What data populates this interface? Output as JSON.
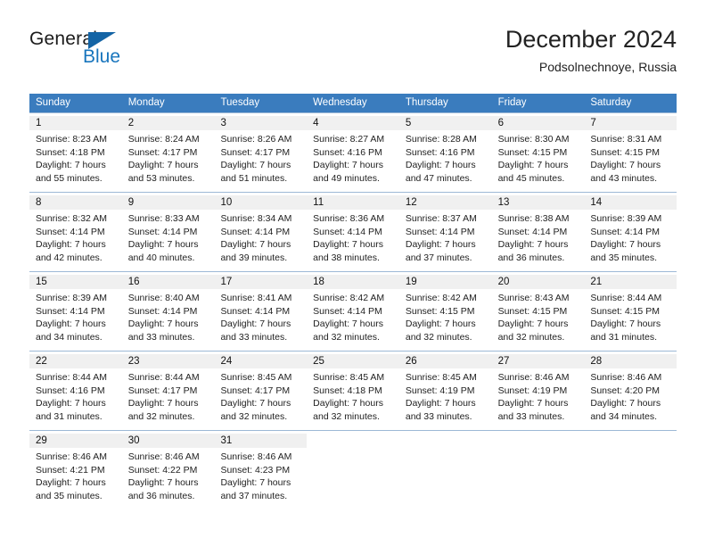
{
  "logo": {
    "word_one": "General",
    "word_two": "Blue",
    "triangle_color": "#1464a5",
    "blue_text_color": "#1875bd"
  },
  "header": {
    "month_year": "December 2024",
    "location": "Podsolnechnoye, Russia"
  },
  "calendar": {
    "header_bg": "#3a7cbe",
    "weekdays": [
      "Sunday",
      "Monday",
      "Tuesday",
      "Wednesday",
      "Thursday",
      "Friday",
      "Saturday"
    ],
    "weeks": [
      [
        {
          "day": "1",
          "sunrise": "Sunrise: 8:23 AM",
          "sunset": "Sunset: 4:18 PM",
          "daylight_line1": "Daylight: 7 hours",
          "daylight_line2": "and 55 minutes."
        },
        {
          "day": "2",
          "sunrise": "Sunrise: 8:24 AM",
          "sunset": "Sunset: 4:17 PM",
          "daylight_line1": "Daylight: 7 hours",
          "daylight_line2": "and 53 minutes."
        },
        {
          "day": "3",
          "sunrise": "Sunrise: 8:26 AM",
          "sunset": "Sunset: 4:17 PM",
          "daylight_line1": "Daylight: 7 hours",
          "daylight_line2": "and 51 minutes."
        },
        {
          "day": "4",
          "sunrise": "Sunrise: 8:27 AM",
          "sunset": "Sunset: 4:16 PM",
          "daylight_line1": "Daylight: 7 hours",
          "daylight_line2": "and 49 minutes."
        },
        {
          "day": "5",
          "sunrise": "Sunrise: 8:28 AM",
          "sunset": "Sunset: 4:16 PM",
          "daylight_line1": "Daylight: 7 hours",
          "daylight_line2": "and 47 minutes."
        },
        {
          "day": "6",
          "sunrise": "Sunrise: 8:30 AM",
          "sunset": "Sunset: 4:15 PM",
          "daylight_line1": "Daylight: 7 hours",
          "daylight_line2": "and 45 minutes."
        },
        {
          "day": "7",
          "sunrise": "Sunrise: 8:31 AM",
          "sunset": "Sunset: 4:15 PM",
          "daylight_line1": "Daylight: 7 hours",
          "daylight_line2": "and 43 minutes."
        }
      ],
      [
        {
          "day": "8",
          "sunrise": "Sunrise: 8:32 AM",
          "sunset": "Sunset: 4:14 PM",
          "daylight_line1": "Daylight: 7 hours",
          "daylight_line2": "and 42 minutes."
        },
        {
          "day": "9",
          "sunrise": "Sunrise: 8:33 AM",
          "sunset": "Sunset: 4:14 PM",
          "daylight_line1": "Daylight: 7 hours",
          "daylight_line2": "and 40 minutes."
        },
        {
          "day": "10",
          "sunrise": "Sunrise: 8:34 AM",
          "sunset": "Sunset: 4:14 PM",
          "daylight_line1": "Daylight: 7 hours",
          "daylight_line2": "and 39 minutes."
        },
        {
          "day": "11",
          "sunrise": "Sunrise: 8:36 AM",
          "sunset": "Sunset: 4:14 PM",
          "daylight_line1": "Daylight: 7 hours",
          "daylight_line2": "and 38 minutes."
        },
        {
          "day": "12",
          "sunrise": "Sunrise: 8:37 AM",
          "sunset": "Sunset: 4:14 PM",
          "daylight_line1": "Daylight: 7 hours",
          "daylight_line2": "and 37 minutes."
        },
        {
          "day": "13",
          "sunrise": "Sunrise: 8:38 AM",
          "sunset": "Sunset: 4:14 PM",
          "daylight_line1": "Daylight: 7 hours",
          "daylight_line2": "and 36 minutes."
        },
        {
          "day": "14",
          "sunrise": "Sunrise: 8:39 AM",
          "sunset": "Sunset: 4:14 PM",
          "daylight_line1": "Daylight: 7 hours",
          "daylight_line2": "and 35 minutes."
        }
      ],
      [
        {
          "day": "15",
          "sunrise": "Sunrise: 8:39 AM",
          "sunset": "Sunset: 4:14 PM",
          "daylight_line1": "Daylight: 7 hours",
          "daylight_line2": "and 34 minutes."
        },
        {
          "day": "16",
          "sunrise": "Sunrise: 8:40 AM",
          "sunset": "Sunset: 4:14 PM",
          "daylight_line1": "Daylight: 7 hours",
          "daylight_line2": "and 33 minutes."
        },
        {
          "day": "17",
          "sunrise": "Sunrise: 8:41 AM",
          "sunset": "Sunset: 4:14 PM",
          "daylight_line1": "Daylight: 7 hours",
          "daylight_line2": "and 33 minutes."
        },
        {
          "day": "18",
          "sunrise": "Sunrise: 8:42 AM",
          "sunset": "Sunset: 4:14 PM",
          "daylight_line1": "Daylight: 7 hours",
          "daylight_line2": "and 32 minutes."
        },
        {
          "day": "19",
          "sunrise": "Sunrise: 8:42 AM",
          "sunset": "Sunset: 4:15 PM",
          "daylight_line1": "Daylight: 7 hours",
          "daylight_line2": "and 32 minutes."
        },
        {
          "day": "20",
          "sunrise": "Sunrise: 8:43 AM",
          "sunset": "Sunset: 4:15 PM",
          "daylight_line1": "Daylight: 7 hours",
          "daylight_line2": "and 32 minutes."
        },
        {
          "day": "21",
          "sunrise": "Sunrise: 8:44 AM",
          "sunset": "Sunset: 4:15 PM",
          "daylight_line1": "Daylight: 7 hours",
          "daylight_line2": "and 31 minutes."
        }
      ],
      [
        {
          "day": "22",
          "sunrise": "Sunrise: 8:44 AM",
          "sunset": "Sunset: 4:16 PM",
          "daylight_line1": "Daylight: 7 hours",
          "daylight_line2": "and 31 minutes."
        },
        {
          "day": "23",
          "sunrise": "Sunrise: 8:44 AM",
          "sunset": "Sunset: 4:17 PM",
          "daylight_line1": "Daylight: 7 hours",
          "daylight_line2": "and 32 minutes."
        },
        {
          "day": "24",
          "sunrise": "Sunrise: 8:45 AM",
          "sunset": "Sunset: 4:17 PM",
          "daylight_line1": "Daylight: 7 hours",
          "daylight_line2": "and 32 minutes."
        },
        {
          "day": "25",
          "sunrise": "Sunrise: 8:45 AM",
          "sunset": "Sunset: 4:18 PM",
          "daylight_line1": "Daylight: 7 hours",
          "daylight_line2": "and 32 minutes."
        },
        {
          "day": "26",
          "sunrise": "Sunrise: 8:45 AM",
          "sunset": "Sunset: 4:19 PM",
          "daylight_line1": "Daylight: 7 hours",
          "daylight_line2": "and 33 minutes."
        },
        {
          "day": "27",
          "sunrise": "Sunrise: 8:46 AM",
          "sunset": "Sunset: 4:19 PM",
          "daylight_line1": "Daylight: 7 hours",
          "daylight_line2": "and 33 minutes."
        },
        {
          "day": "28",
          "sunrise": "Sunrise: 8:46 AM",
          "sunset": "Sunset: 4:20 PM",
          "daylight_line1": "Daylight: 7 hours",
          "daylight_line2": "and 34 minutes."
        }
      ],
      [
        {
          "day": "29",
          "sunrise": "Sunrise: 8:46 AM",
          "sunset": "Sunset: 4:21 PM",
          "daylight_line1": "Daylight: 7 hours",
          "daylight_line2": "and 35 minutes."
        },
        {
          "day": "30",
          "sunrise": "Sunrise: 8:46 AM",
          "sunset": "Sunset: 4:22 PM",
          "daylight_line1": "Daylight: 7 hours",
          "daylight_line2": "and 36 minutes."
        },
        {
          "day": "31",
          "sunrise": "Sunrise: 8:46 AM",
          "sunset": "Sunset: 4:23 PM",
          "daylight_line1": "Daylight: 7 hours",
          "daylight_line2": "and 37 minutes."
        },
        {
          "day": "",
          "sunrise": "",
          "sunset": "",
          "daylight_line1": "",
          "daylight_line2": ""
        },
        {
          "day": "",
          "sunrise": "",
          "sunset": "",
          "daylight_line1": "",
          "daylight_line2": ""
        },
        {
          "day": "",
          "sunrise": "",
          "sunset": "",
          "daylight_line1": "",
          "daylight_line2": ""
        },
        {
          "day": "",
          "sunrise": "",
          "sunset": "",
          "daylight_line1": "",
          "daylight_line2": ""
        }
      ]
    ]
  }
}
